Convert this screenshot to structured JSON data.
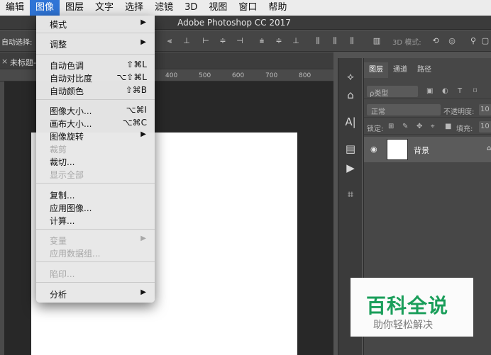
{
  "menubar": {
    "items": [
      "编辑",
      "图像",
      "图层",
      "文字",
      "选择",
      "滤镜",
      "3D",
      "视图",
      "窗口",
      "帮助"
    ],
    "active_index": 1
  },
  "window": {
    "title": "Adobe Photoshop CC 2017"
  },
  "options_bar": {
    "auto_select_label": "自动选择:",
    "mode_3d_label": "3D 模式:"
  },
  "document": {
    "tab_title": "未标题-",
    "close_glyph": "×"
  },
  "ruler": {
    "ticks": [
      "400",
      "500",
      "600",
      "700",
      "800"
    ]
  },
  "image_menu": {
    "items": [
      {
        "label": "模式",
        "shortcut": "",
        "submenu": true,
        "disabled": false
      },
      {
        "label": "调整",
        "shortcut": "",
        "submenu": true,
        "disabled": false
      },
      {
        "label": "自动色调",
        "shortcut": "⇧⌘L",
        "submenu": false,
        "disabled": false
      },
      {
        "label": "自动对比度",
        "shortcut": "⌥⇧⌘L",
        "submenu": false,
        "disabled": false
      },
      {
        "label": "自动颜色",
        "shortcut": "⇧⌘B",
        "submenu": false,
        "disabled": false
      },
      {
        "label": "图像大小...",
        "shortcut": "⌥⌘I",
        "submenu": false,
        "disabled": false
      },
      {
        "label": "画布大小...",
        "shortcut": "⌥⌘C",
        "submenu": false,
        "disabled": false
      },
      {
        "label": "图像旋转",
        "shortcut": "",
        "submenu": true,
        "disabled": false
      },
      {
        "label": "裁剪",
        "shortcut": "",
        "submenu": false,
        "disabled": true
      },
      {
        "label": "裁切...",
        "shortcut": "",
        "submenu": false,
        "disabled": false
      },
      {
        "label": "显示全部",
        "shortcut": "",
        "submenu": false,
        "disabled": true
      },
      {
        "label": "复制...",
        "shortcut": "",
        "submenu": false,
        "disabled": false
      },
      {
        "label": "应用图像...",
        "shortcut": "",
        "submenu": false,
        "disabled": false
      },
      {
        "label": "计算...",
        "shortcut": "",
        "submenu": false,
        "disabled": false
      },
      {
        "label": "变量",
        "shortcut": "",
        "submenu": true,
        "disabled": true
      },
      {
        "label": "应用数据组...",
        "shortcut": "",
        "submenu": false,
        "disabled": true
      },
      {
        "label": "陷印...",
        "shortcut": "",
        "submenu": false,
        "disabled": true
      },
      {
        "label": "分析",
        "shortcut": "",
        "submenu": true,
        "disabled": false
      }
    ]
  },
  "layers_panel": {
    "tabs": [
      "图层",
      "通道",
      "路径"
    ],
    "active_tab": 0,
    "filter_label": "ρ类型",
    "blend_mode": "正常",
    "opacity_label": "不透明度:",
    "opacity_value": "10",
    "lock_label": "锁定:",
    "fill_label": "填充:",
    "fill_value": "10",
    "layers": [
      {
        "name": "背景",
        "visible": true
      }
    ]
  },
  "watermark": {
    "title": "百科全说",
    "subtitle": "助你轻松解决"
  },
  "colors": {
    "menu_highlight": "#2f74d6",
    "canvas": "#ffffff",
    "workspace": "#282828",
    "watermark_green": "#1a9e5a"
  }
}
